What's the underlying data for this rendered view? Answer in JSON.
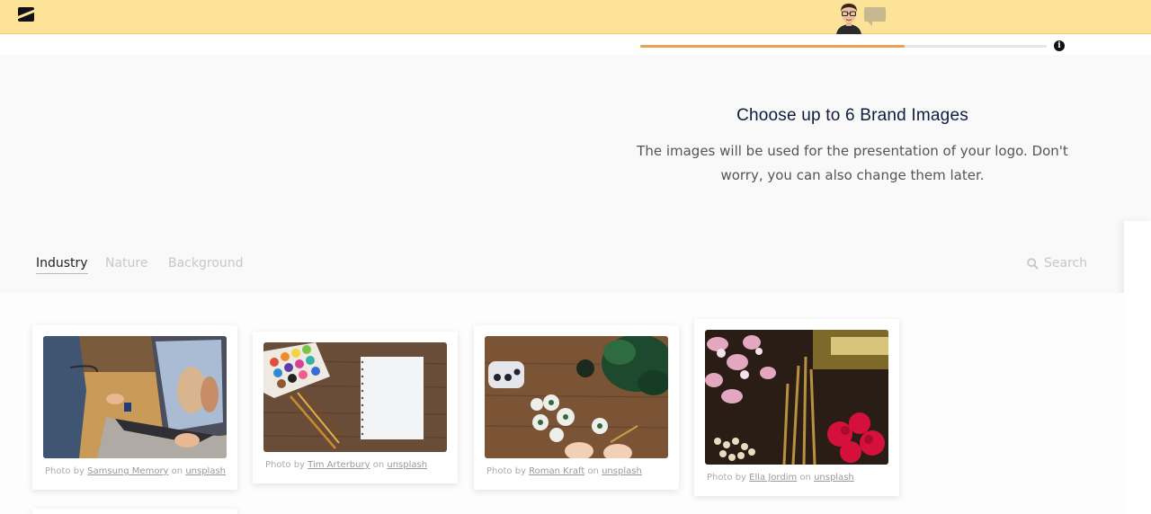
{
  "header": {
    "logo_icon": "brand-slash-logo",
    "avatar_icon": "assistant-avatar",
    "chat_icon": "speech-bubble-icon",
    "brand_color": "#fde398"
  },
  "progress": {
    "fraction": 0.65,
    "color": "#eba04b",
    "info_label": "i"
  },
  "intro": {
    "title": "Choose up to 6 Brand Images",
    "subtitle": "The images will be used for the presentation of your logo. Don't worry, you can also change them later."
  },
  "tabs": [
    {
      "label": "Industry",
      "active": true
    },
    {
      "label": "Nature",
      "active": false
    },
    {
      "label": "Background",
      "active": false
    }
  ],
  "search": {
    "label": "Search",
    "icon": "search-icon"
  },
  "images": [
    {
      "subject": "laptop-video-call",
      "prefix": "Photo by",
      "author": "Samsung Memory",
      "on": "on",
      "source": "unsplash"
    },
    {
      "subject": "watercolors-notebook",
      "prefix": "Photo by",
      "author": "Tim Arterbury",
      "on": "on",
      "source": "unsplash"
    },
    {
      "subject": "painting-on-stones",
      "prefix": "Photo by",
      "author": "Roman Kraft",
      "on": "on",
      "source": "unsplash"
    },
    {
      "subject": "flowers-and-brushes",
      "prefix": "Photo by",
      "author": "Ella Jordim",
      "on": "on",
      "source": "unsplash"
    }
  ]
}
